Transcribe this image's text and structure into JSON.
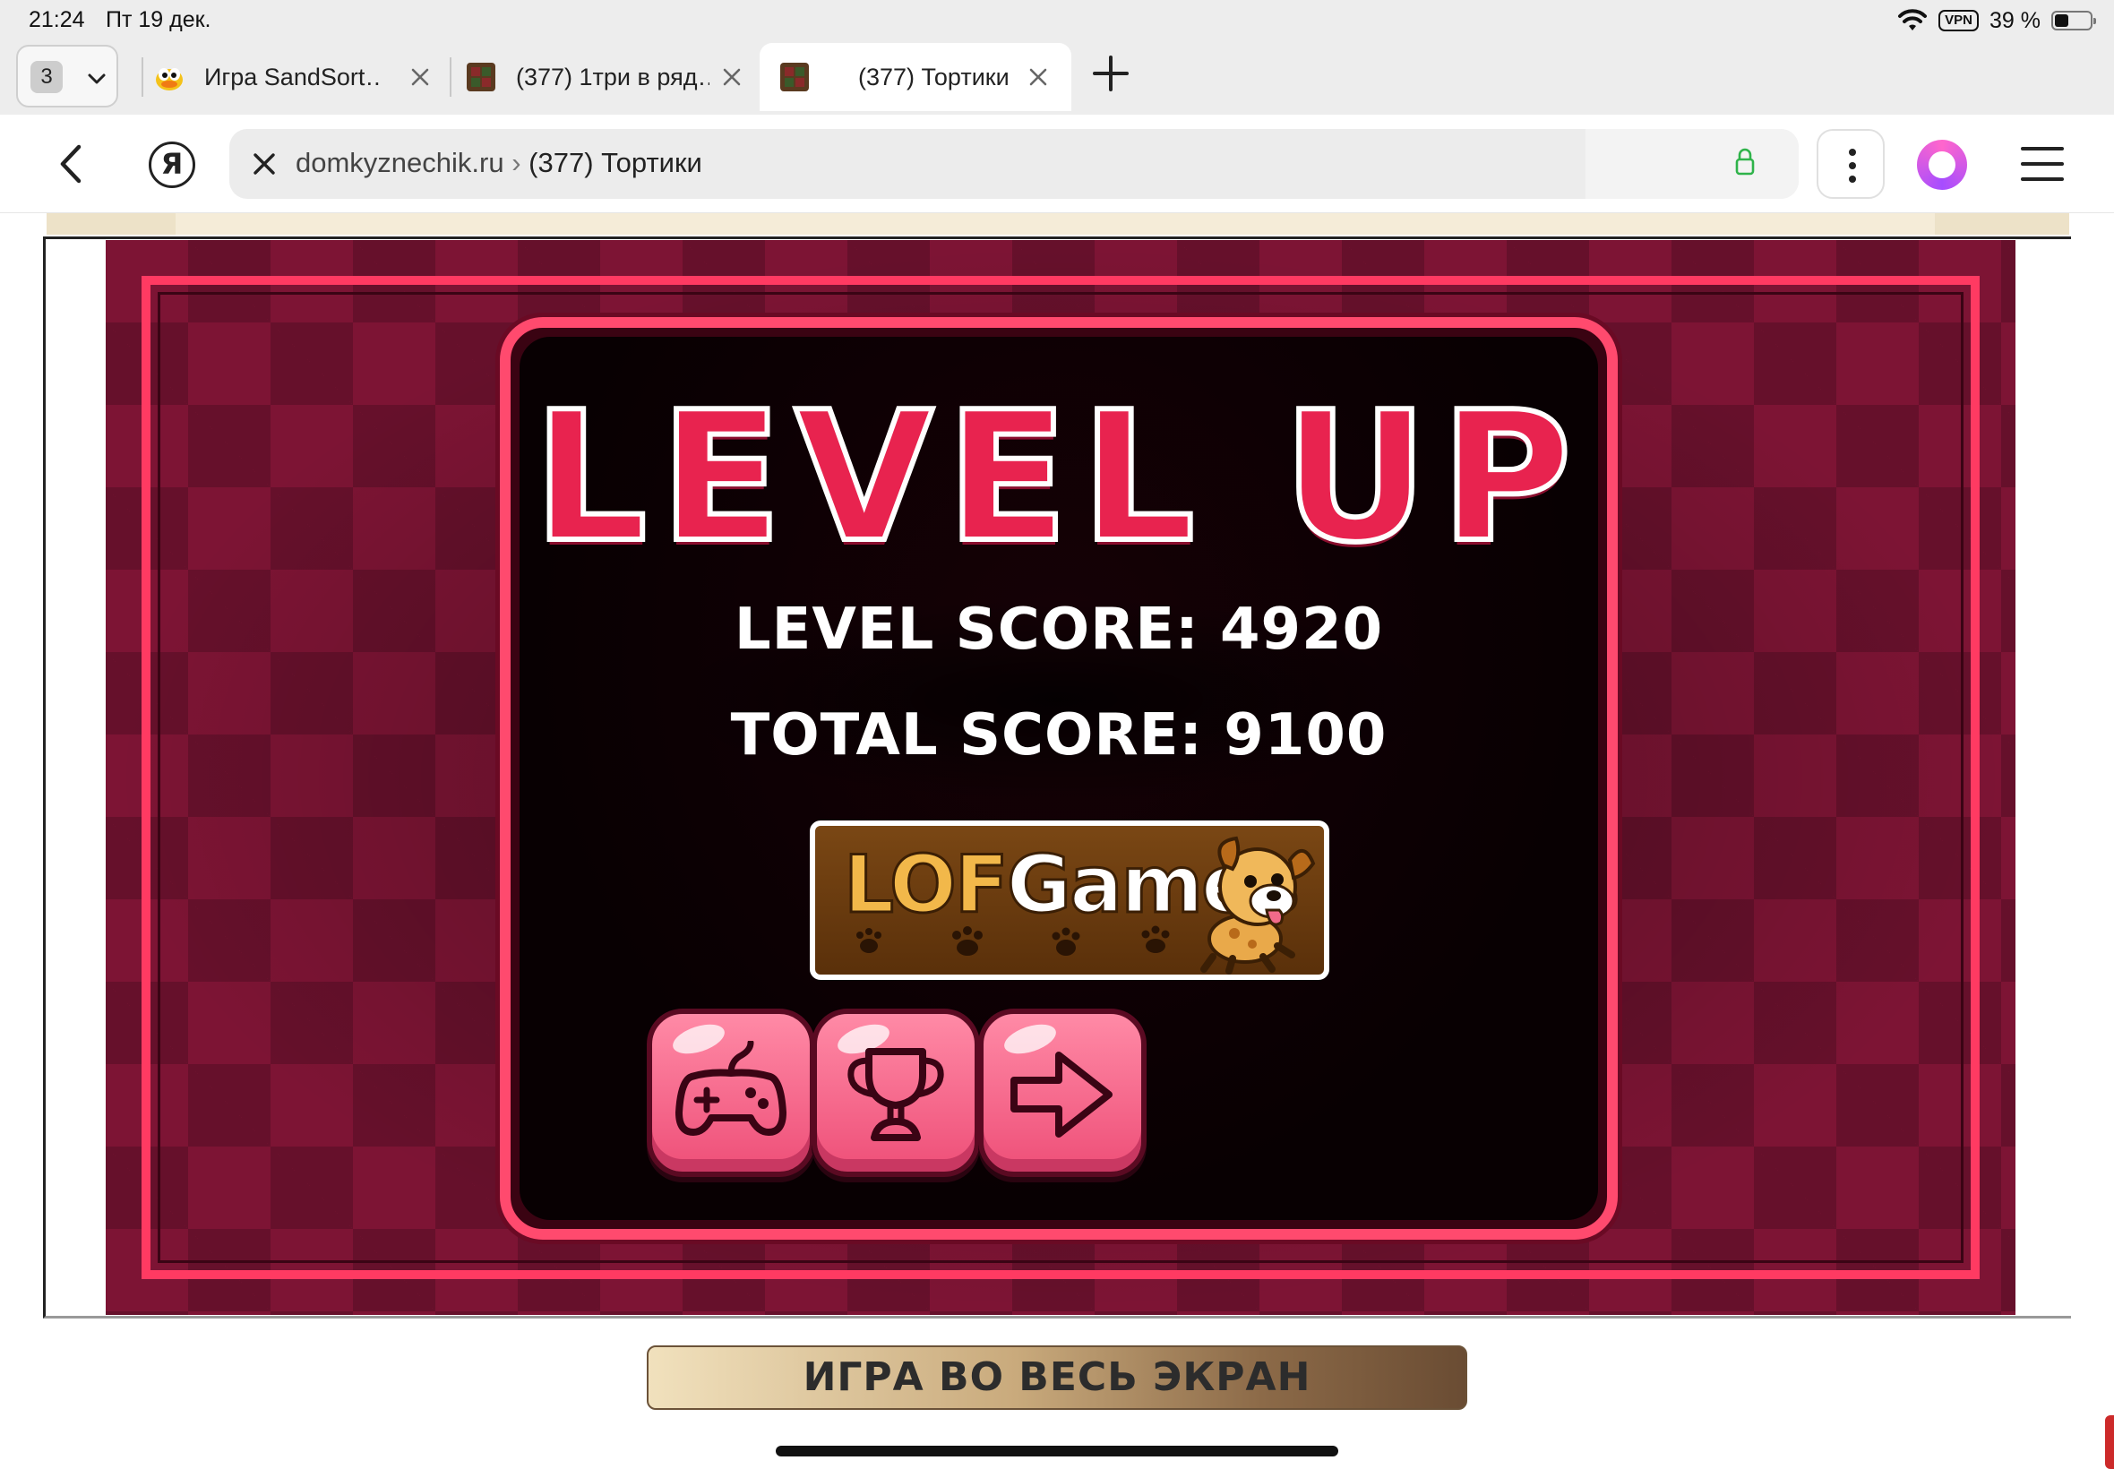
{
  "status_bar": {
    "time": "21:24",
    "date": "Пт 19 дек.",
    "vpn_label": "VPN",
    "battery_text": "39 %",
    "battery_level": 0.39
  },
  "tabs": {
    "count": "3",
    "items": [
      {
        "title": "Игра SandSort…",
        "favicon": "duck-favicon"
      },
      {
        "title": "(377) 1три в ряд…",
        "favicon": "cake-game-favicon"
      },
      {
        "title": "(377) Тортики",
        "favicon": "cake-game-favicon",
        "active": true
      }
    ]
  },
  "address_bar": {
    "domain": "domkyznechik.ru",
    "separator": "›",
    "page_title": "(377) Тортики"
  },
  "game": {
    "heading": "LEVEL UP",
    "level_score_label": "LEVEL SCORE:",
    "level_score": "4920",
    "total_score_label": "TOTAL SCORE:",
    "total_score": "9100",
    "sponsor_logo_text": "LOFGames",
    "buttons": [
      {
        "name": "more-games-button",
        "icon": "gamepad-icon"
      },
      {
        "name": "leaderboard-button",
        "icon": "trophy-icon"
      },
      {
        "name": "next-level-button",
        "icon": "arrow-right-icon"
      }
    ],
    "accent_color": "#ff3a62",
    "background_color": "#7d1434"
  },
  "page": {
    "fullscreen_button": "ИГРА ВО ВЕСЬ ЭКРАН"
  }
}
